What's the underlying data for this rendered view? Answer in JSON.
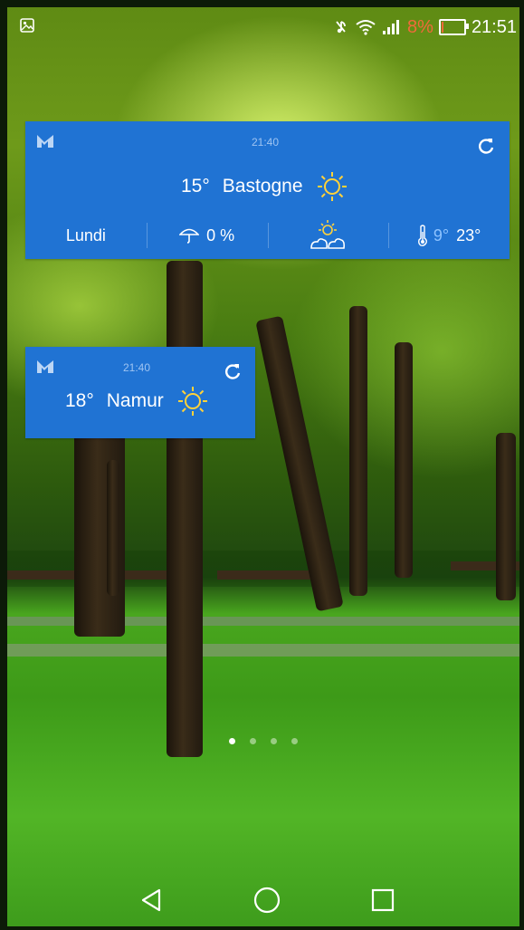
{
  "status_bar": {
    "time": "21:51",
    "battery_percent": "8%",
    "battery_level": 0.08,
    "icons": [
      "gallery-notification-icon",
      "mute-icon",
      "wifi-icon",
      "signal-icon",
      "battery-icon"
    ]
  },
  "widgets": [
    {
      "id": "bastogne",
      "time": "21:40",
      "temperature": "15°",
      "city": "Bastogne",
      "condition_icon": "sun-icon",
      "day": "Lundi",
      "rain_chance": "0 %",
      "forecast_icon": "partly-cloudy-icon",
      "min_temp": "9°",
      "max_temp": "23°"
    },
    {
      "id": "namur",
      "time": "21:40",
      "temperature": "18°",
      "city": "Namur",
      "condition_icon": "sun-icon"
    }
  ],
  "home_pages": {
    "count": 4,
    "active_index": 0
  },
  "nav_bar": {
    "buttons": [
      "back-icon",
      "home-icon",
      "recents-icon"
    ]
  },
  "colors": {
    "widget_background": "#2073d3",
    "battery_low": "#f06a3a",
    "min_temp": "#8ec3ff"
  }
}
